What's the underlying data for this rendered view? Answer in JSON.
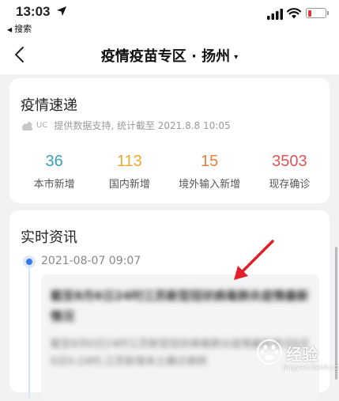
{
  "status_bar": {
    "time": "13:03",
    "back_app": "搜索",
    "icons": [
      "location-arrow-icon",
      "cellular-signal-icon",
      "wifi-icon",
      "battery-low-icon"
    ]
  },
  "nav": {
    "title": "疫情疫苗专区 · 扬州",
    "caret": "▾",
    "back_icon": "chevron-left-icon"
  },
  "overview": {
    "title": "疫情速递",
    "source_logo": "UC",
    "source": "提供数据支持, 统计截至 2021.8.8 10:05",
    "stats": [
      {
        "value": "36",
        "label": "本市新增",
        "color": "#3a9fb5"
      },
      {
        "value": "113",
        "label": "国内新增",
        "color": "#f0a732"
      },
      {
        "value": "15",
        "label": "境外输入新增",
        "color": "#f07d3a"
      },
      {
        "value": "3503",
        "label": "现存确诊",
        "color": "#e05558"
      }
    ]
  },
  "news": {
    "title": "实时资讯",
    "items": [
      {
        "time": "2021-08-07 09:07",
        "headline": "截至8月6日24时江苏新型冠状病毒肺炎疫情最新情况",
        "summary": "截至8月6日24时江苏新型冠状病毒肺炎疫情最新情况8月6日0-24时,江苏新增本土确诊病例"
      }
    ]
  },
  "watermark": {
    "text": "经验",
    "url": "jingyan.baidu.com"
  },
  "colors": {
    "accent": "#3478f6",
    "arrow": "#e0202a",
    "battery": "#e53935"
  }
}
